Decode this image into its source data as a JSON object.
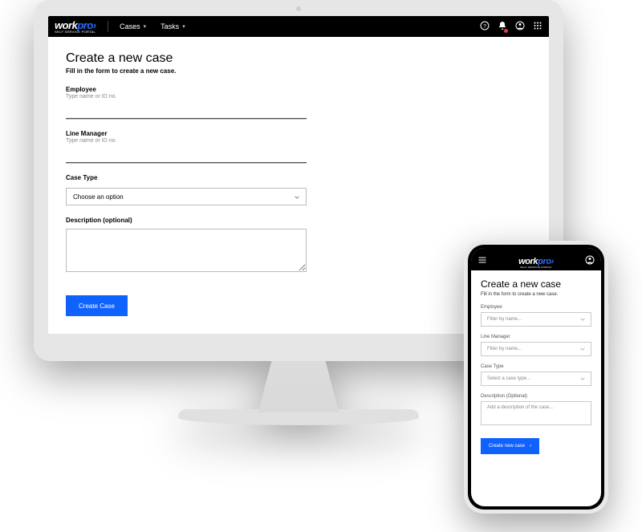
{
  "brand": {
    "name1": "work",
    "name2": "pro",
    "tagline": "SELF SERVICE PORTAL"
  },
  "desktop": {
    "nav": {
      "cases": "Cases",
      "tasks": "Tasks"
    },
    "page": {
      "title": "Create a new case",
      "subtitle": "Fill in the form to create a new case."
    },
    "fields": {
      "employee": {
        "label": "Employee",
        "hint": "Type name or ID no."
      },
      "lineManager": {
        "label": "Line Manager",
        "hint": "Type name or ID no."
      },
      "caseType": {
        "label": "Case Type",
        "placeholder": "Choose an option"
      },
      "description": {
        "label": "Description (optional)"
      }
    },
    "submit": "Create Case"
  },
  "mobile": {
    "page": {
      "title": "Create a new case",
      "subtitle": "Fill in the form to create a new case."
    },
    "fields": {
      "employee": {
        "label": "Employee",
        "placeholder": "Filter by name..."
      },
      "lineManager": {
        "label": "Line Manager",
        "placeholder": "Filter by name..."
      },
      "caseType": {
        "label": "Case Type",
        "placeholder": "Select a case type..."
      },
      "description": {
        "label": "Description (Optional)",
        "placeholder": "Add a description of the case..."
      }
    },
    "submit": "Create new case"
  }
}
